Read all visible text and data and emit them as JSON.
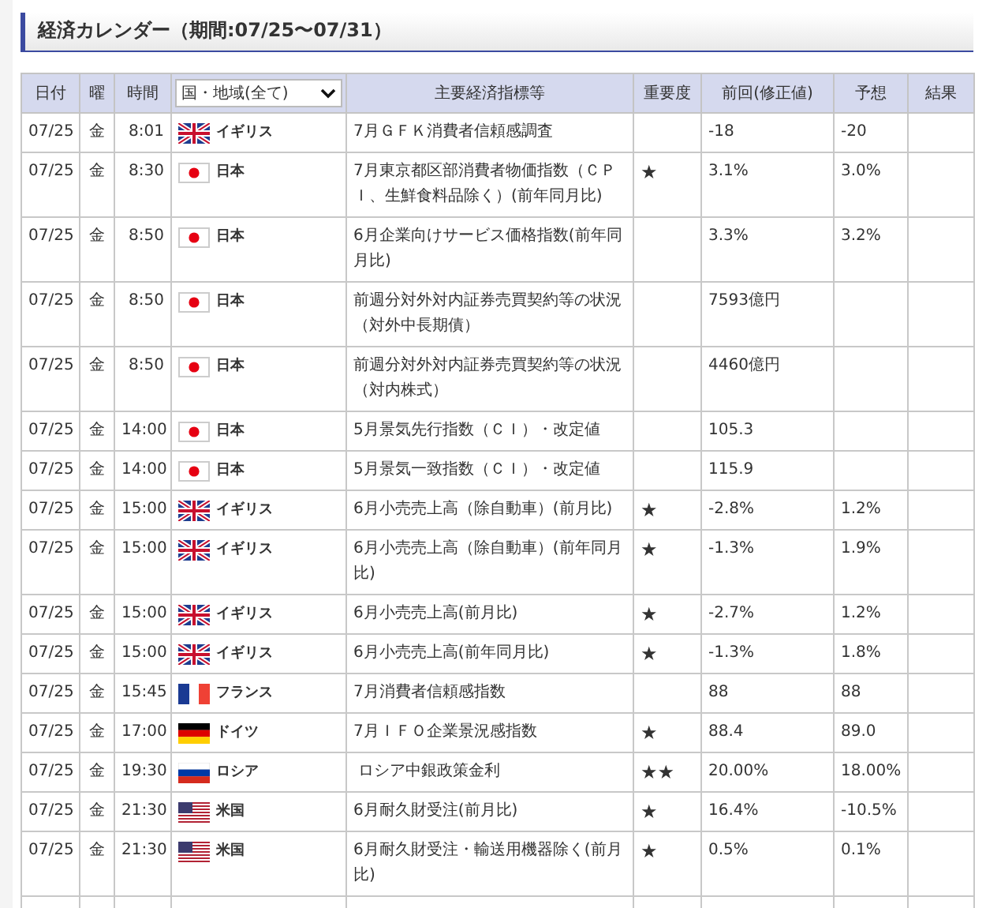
{
  "title": "経済カレンダー（期間:07/25〜07/31）",
  "table": {
    "columns": [
      "日付",
      "曜",
      "時間",
      "主要経済指標等",
      "重要度",
      "前回(修正値)",
      "予想",
      "結果"
    ],
    "region_filter": "国・地域(全て)",
    "rows": [
      {
        "date": "07/25",
        "day": "金",
        "time": "8:01",
        "kind": "gb",
        "country": "イギリス",
        "indicator": "7月ＧＦＫ消費者信頼感調査",
        "previous": "-18",
        "forecast": "-20"
      },
      {
        "date": "07/25",
        "day": "金",
        "time": "8:30",
        "kind": "jp",
        "country": "日本",
        "indicator": "7月東京都区部消費者物価指数（ＣＰＩ、生鮮食料品除く）(前年同月比)",
        "importance": "★",
        "previous": "3.1%",
        "forecast": "3.0%"
      },
      {
        "date": "07/25",
        "day": "金",
        "time": "8:50",
        "kind": "jp",
        "country": "日本",
        "indicator": "6月企業向けサービス価格指数(前年同月比)",
        "previous": "3.3%",
        "forecast": "3.2%"
      },
      {
        "date": "07/25",
        "day": "金",
        "time": "8:50",
        "kind": "jp",
        "country": "日本",
        "indicator": "前週分対外対内証券売買契約等の状況（対外中長期債）",
        "previous": "7593億円"
      },
      {
        "date": "07/25",
        "day": "金",
        "time": "8:50",
        "kind": "jp",
        "country": "日本",
        "indicator": "前週分対外対内証券売買契約等の状況（対内株式）",
        "previous": "4460億円"
      },
      {
        "date": "07/25",
        "day": "金",
        "time": "14:00",
        "kind": "jp",
        "country": "日本",
        "indicator": "5月景気先行指数（ＣＩ）・改定値",
        "previous": "105.3"
      },
      {
        "date": "07/25",
        "day": "金",
        "time": "14:00",
        "kind": "jp",
        "country": "日本",
        "indicator": "5月景気一致指数（ＣＩ）・改定値",
        "previous": "115.9"
      },
      {
        "date": "07/25",
        "day": "金",
        "time": "15:00",
        "kind": "gb",
        "country": "イギリス",
        "indicator": "6月小売売上高（除自動車）(前月比)",
        "importance": "★",
        "previous": "-2.8%",
        "forecast": "1.2%"
      },
      {
        "date": "07/25",
        "day": "金",
        "time": "15:00",
        "kind": "gb",
        "country": "イギリス",
        "indicator": "6月小売売上高（除自動車）(前年同月比)",
        "importance": "★",
        "previous": "-1.3%",
        "forecast": "1.9%"
      },
      {
        "date": "07/25",
        "day": "金",
        "time": "15:00",
        "kind": "gb",
        "country": "イギリス",
        "indicator": "6月小売売上高(前月比)",
        "importance": "★",
        "previous": "-2.7%",
        "forecast": "1.2%"
      },
      {
        "date": "07/25",
        "day": "金",
        "time": "15:00",
        "kind": "gb",
        "country": "イギリス",
        "indicator": "6月小売売上高(前年同月比)",
        "importance": "★",
        "previous": "-1.3%",
        "forecast": "1.8%"
      },
      {
        "date": "07/25",
        "day": "金",
        "time": "15:45",
        "kind": "fr",
        "country": "フランス",
        "indicator": "7月消費者信頼感指数",
        "previous": "88",
        "forecast": "88"
      },
      {
        "date": "07/25",
        "day": "金",
        "time": "17:00",
        "kind": "de",
        "country": "ドイツ",
        "indicator": "7月ＩＦＯ企業景況感指数",
        "importance": "★",
        "previous": "88.4",
        "forecast": "89.0"
      },
      {
        "date": "07/25",
        "day": "金",
        "time": "19:30",
        "kind": "ru",
        "country": "ロシア",
        "indicator": " ロシア中銀政策金利",
        "importance": "★★",
        "previous": "20.00%",
        "forecast": "18.00%"
      },
      {
        "date": "07/25",
        "day": "金",
        "time": "21:30",
        "kind": "us",
        "country": "米国",
        "indicator": "6月耐久財受注(前月比)",
        "importance": "★",
        "previous": "16.4%",
        "forecast": "-10.5%"
      },
      {
        "date": "07/25",
        "day": "金",
        "time": "21:30",
        "kind": "us",
        "country": "米国",
        "indicator": "6月耐久財受注・輸送用機器除く(前月比)",
        "importance": "★",
        "previous": "0.5%",
        "forecast": "0.1%"
      }
    ]
  }
}
